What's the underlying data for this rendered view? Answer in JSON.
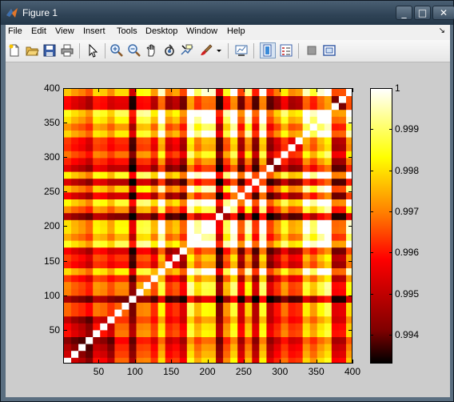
{
  "window": {
    "title": "Figure 1",
    "controls": {
      "minimize": "_",
      "maximize": "□",
      "close": "✕"
    }
  },
  "menu": {
    "items": [
      "File",
      "Edit",
      "View",
      "Insert",
      "Tools",
      "Desktop",
      "Window",
      "Help"
    ],
    "dock_glyph": "↘"
  },
  "toolbar": {
    "buttons": [
      {
        "name": "new-figure-icon"
      },
      {
        "name": "open-file-icon"
      },
      {
        "name": "save-figure-icon"
      },
      {
        "name": "print-figure-icon"
      },
      {
        "name": "edit-plot-icon"
      },
      {
        "name": "zoom-in-icon"
      },
      {
        "name": "zoom-out-icon"
      },
      {
        "name": "pan-icon"
      },
      {
        "name": "rotate-3d-icon"
      },
      {
        "name": "data-cursor-icon"
      },
      {
        "name": "brush-icon"
      },
      {
        "name": "brush-dropdown-icon"
      },
      {
        "name": "link-plot-icon"
      },
      {
        "name": "insert-colorbar-icon",
        "pressed": true
      },
      {
        "name": "insert-legend-icon"
      },
      {
        "name": "hide-plot-tools-icon"
      },
      {
        "name": "show-plot-tools-icon"
      }
    ]
  },
  "chart_data": {
    "type": "heatmap",
    "colormap": "hot",
    "xlim": [
      1,
      400
    ],
    "ylim": [
      1,
      400
    ],
    "x_ticks": [
      50,
      100,
      150,
      200,
      250,
      300,
      350,
      400
    ],
    "x_tick_labels": [
      "50",
      "100",
      "150",
      "200",
      "250",
      "300",
      "350",
      "400"
    ],
    "y_ticks": [
      50,
      100,
      150,
      200,
      250,
      300,
      350,
      400
    ],
    "y_tick_labels": [
      "50",
      "100",
      "150",
      "200",
      "250",
      "300",
      "350",
      "400"
    ],
    "colorbar": {
      "range": [
        0.9933,
        1.0
      ],
      "ticks": [
        0.994,
        0.995,
        0.996,
        0.997,
        0.998,
        0.999,
        1
      ],
      "tick_labels": [
        "0.994",
        "0.995",
        "0.996",
        "0.997",
        "0.998",
        "0.999",
        "1"
      ]
    },
    "grid_size": 40,
    "note_values": "symmetric-correlation-matrix-approximation"
  }
}
